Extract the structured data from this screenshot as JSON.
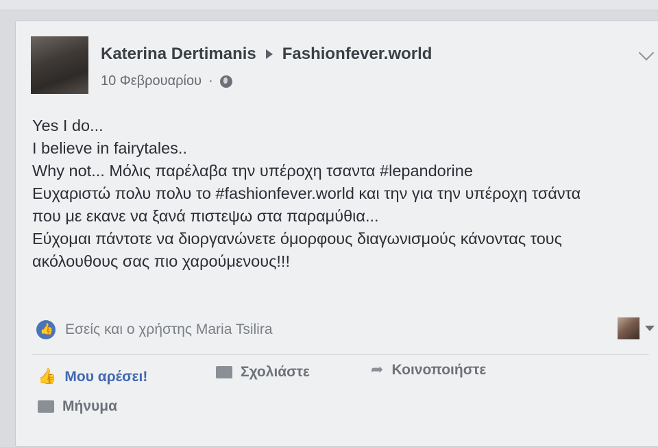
{
  "post": {
    "author": "Katerina Dertimanis",
    "target_page": "Fashionfever.world",
    "date": "10 Φεβρουαρίου",
    "separator": "·",
    "privacy_icon": "globe-icon",
    "lines": [
      "Yes I do...",
      "I believe in fairytales..",
      "Why not... Μόλις παρέλαβα την υπέροχη τσαντα #lepandorine",
      "Ευχαριστώ πολυ πολυ το #fashionfever.world και την για την υπέροχη τσάντα",
      "που με εκανε να ξανά πιστεψω στα παραμύθια...",
      "Εύχομαι πάντοτε να διοργανώνετε όμορφους διαγωνισμούς κάνοντας τους",
      "ακόλουθους σας πιο χαρούμενους!!!"
    ]
  },
  "reactions": {
    "text": "Εσείς και ο χρήστης Maria Tsilira",
    "icon": "like-circle-icon"
  },
  "actions": {
    "like": "Μου αρέσει!",
    "comment": "Σχολιάστε",
    "share": "Κοινοποιήστε",
    "message": "Μήνυμα"
  },
  "colors": {
    "like_blue": "#4167b1",
    "card_bg": "#eef0f2"
  }
}
